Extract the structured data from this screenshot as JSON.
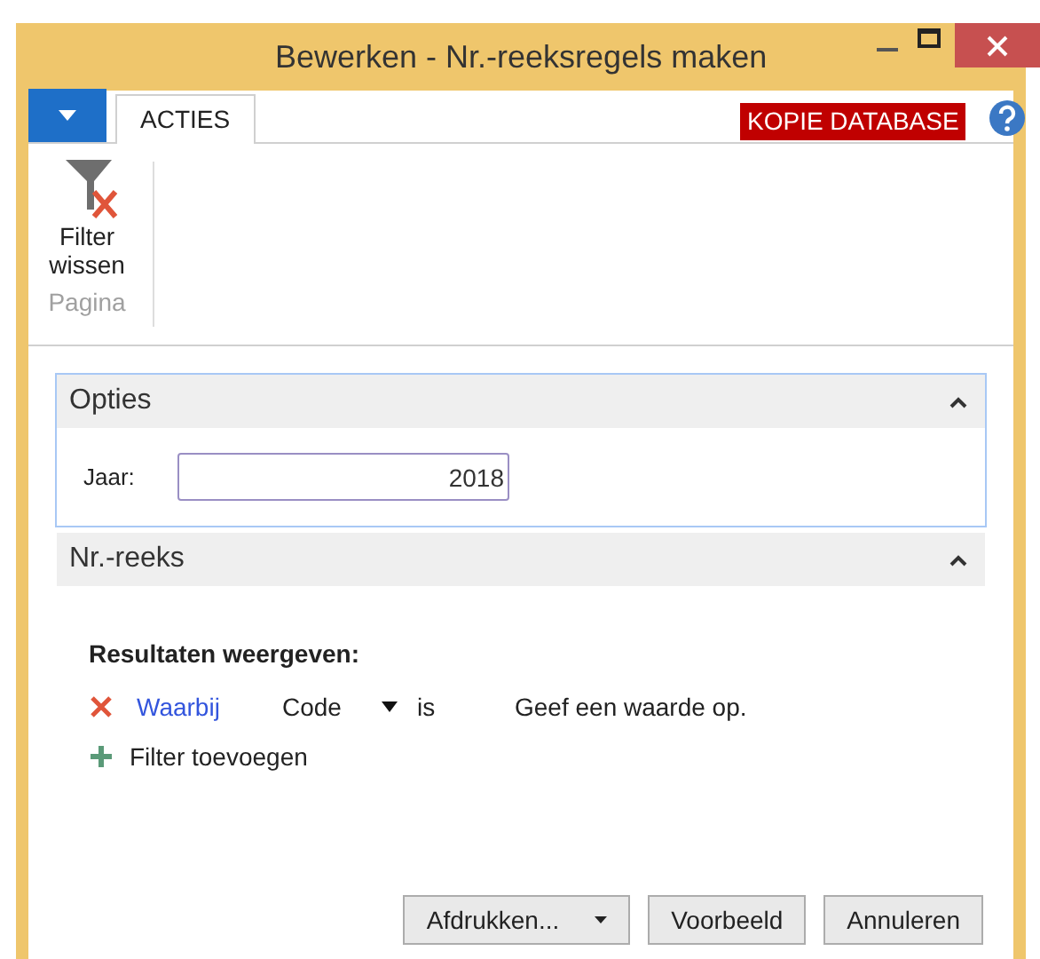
{
  "window": {
    "title": "Bewerken - Nr.-reeksregels maken"
  },
  "ribbon": {
    "tabs": [
      {
        "label": "ACTIES",
        "selected": true
      }
    ],
    "badge": "KOPIE DATABASE",
    "groups": [
      {
        "label": "Pagina",
        "actions": [
          {
            "label": "Filter wissen"
          }
        ]
      }
    ]
  },
  "sections": [
    {
      "title": "Opties",
      "expanded": true,
      "focused": true,
      "kind": "fields",
      "fields": [
        {
          "label": "Jaar:",
          "value": "2018"
        }
      ]
    },
    {
      "title": "Nr.-reeks",
      "expanded": true,
      "focused": false,
      "kind": "filters",
      "heading": "Resultaten weergeven:",
      "filters": [
        {
          "prefix": "Waarbij",
          "field": "Code",
          "operator": "is",
          "placeholder": "Geef een waarde op."
        }
      ],
      "add_label": "Filter toevoegen"
    }
  ],
  "buttons": [
    {
      "label": "Afdrukken...",
      "has_menu": true
    },
    {
      "label": "Voorbeeld",
      "has_menu": false
    },
    {
      "label": "Annuleren",
      "has_menu": false
    }
  ]
}
